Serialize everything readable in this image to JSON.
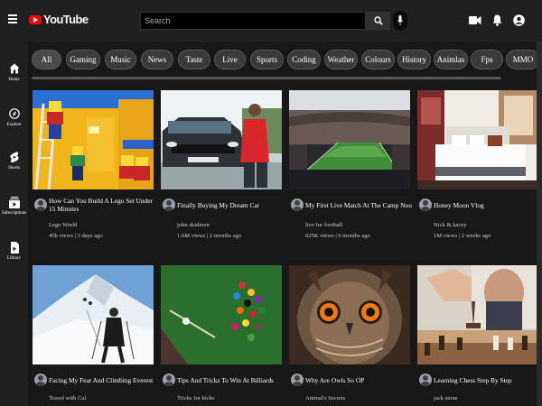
{
  "header": {
    "logo_text": "YouTube",
    "search_placeholder": "Search",
    "icons": [
      "hamburger-icon",
      "youtube-logo-icon",
      "search-icon",
      "mic-icon",
      "video-camera-icon",
      "bell-icon",
      "account-icon"
    ]
  },
  "sidebar": {
    "items": [
      {
        "label": "Home",
        "icon": "home-icon"
      },
      {
        "label": "Explore",
        "icon": "compass-icon"
      },
      {
        "label": "Shorts",
        "icon": "shorts-icon"
      },
      {
        "label": "Subscriptions",
        "icon": "subscriptions-icon"
      },
      {
        "label": "Library",
        "icon": "library-icon"
      }
    ]
  },
  "chips": [
    "All",
    "Gaming",
    "Music",
    "News",
    "Taste",
    "Live",
    "Sports",
    "Coding",
    "Weather",
    "Colours",
    "History",
    "Animlas",
    "Fps",
    "MMO"
  ],
  "videos": [
    {
      "title": "How Can You Build A Lego Set Under 15 Minutes",
      "channel": "Lego World",
      "meta": "45k views | 3 days ago"
    },
    {
      "title": "Finally Buying My Dream Car",
      "channel": "john skidmen",
      "meta": "1.6M views | 2 months ago"
    },
    {
      "title": "My First Live Match At The Camp Nou",
      "channel": "live for football",
      "meta": "625K views | 6 months ago"
    },
    {
      "title": "Honey Moon Vlog",
      "channel": "Nick & kacey",
      "meta": "1M views | 2 weeks ago"
    },
    {
      "title": "Facing My Fear And Climbing Everest",
      "channel": "Travel with Cal",
      "meta": ""
    },
    {
      "title": "Tips And Tricks To Win At Billiards",
      "channel": "Tricks for kicks",
      "meta": ""
    },
    {
      "title": "Why Are Owls So OP",
      "channel": "Animal's Secrets",
      "meta": ""
    },
    {
      "title": "Learning Chess Step By Step",
      "channel": "jack stone",
      "meta": ""
    }
  ],
  "colors": {
    "background": "#181818",
    "header": "#202020",
    "brand_red": "#ff0000",
    "chip": "#3a3a3a"
  }
}
